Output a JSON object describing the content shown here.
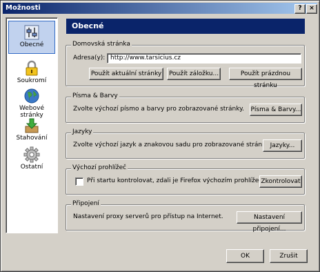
{
  "window": {
    "title": "Možnosti",
    "help_label": "?",
    "close_label": "×"
  },
  "sidebar": {
    "items": [
      {
        "label": "Obecné",
        "icon": "general-icon",
        "selected": true
      },
      {
        "label": "Soukromí",
        "icon": "privacy-lock-icon"
      },
      {
        "label": "Webové stránky",
        "icon": "globe-icon"
      },
      {
        "label": "Stahování",
        "icon": "download-icon"
      },
      {
        "label": "Ostatní",
        "icon": "gear-icon"
      }
    ]
  },
  "panel": {
    "title": "Obecné"
  },
  "homepage": {
    "group_label": "Domovská stránka",
    "address_label": "Adresa(y):",
    "address_value": "http://www.tarsicius.cz",
    "btn_current": "Použít aktuální stránky",
    "btn_bookmark": "Použít záložku...",
    "btn_blank": "Použít prázdnou stránku"
  },
  "fonts": {
    "group_label": "Písma & Barvy",
    "description": "Zvolte výchozí písmo a barvy pro zobrazované stránky.",
    "button": "Písma & Barvy..."
  },
  "languages": {
    "group_label": "Jazyky",
    "description": "Zvolte výchozí jazyk a znakovou sadu pro zobrazované stránky.",
    "button": "Jazyky..."
  },
  "default_browser": {
    "group_label": "Výchozí prohlížeč",
    "checkbox_label": "Při startu kontrolovat, zdali je Firefox výchozím prohlížečem.",
    "checked": false,
    "button": "Zkontrolovat"
  },
  "connection": {
    "group_label": "Připojení",
    "description": "Nastavení proxy serverů pro přístup na Internet.",
    "button": "Nastavení připojení..."
  },
  "footer": {
    "ok_label": "OK",
    "cancel_label": "Zrušit"
  }
}
